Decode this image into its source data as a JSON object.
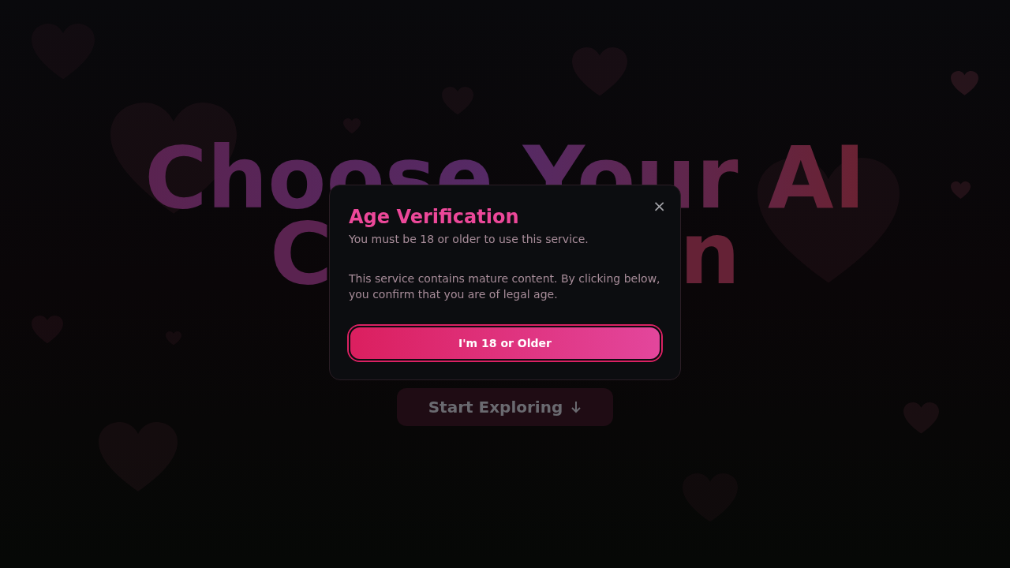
{
  "hero": {
    "heading_line_1": "Choose Your AI",
    "heading_line_2_left": "C",
    "heading_line_2_right": "n",
    "cta": "Start Exploring"
  },
  "dialog": {
    "title": "Age Verification",
    "subtitle": "You must be 18 or older to use this service.",
    "body": "This service contains mature content. By clicking below, you confirm that you are of legal age.",
    "confirm": "I'm 18 or Older",
    "close": "×"
  }
}
